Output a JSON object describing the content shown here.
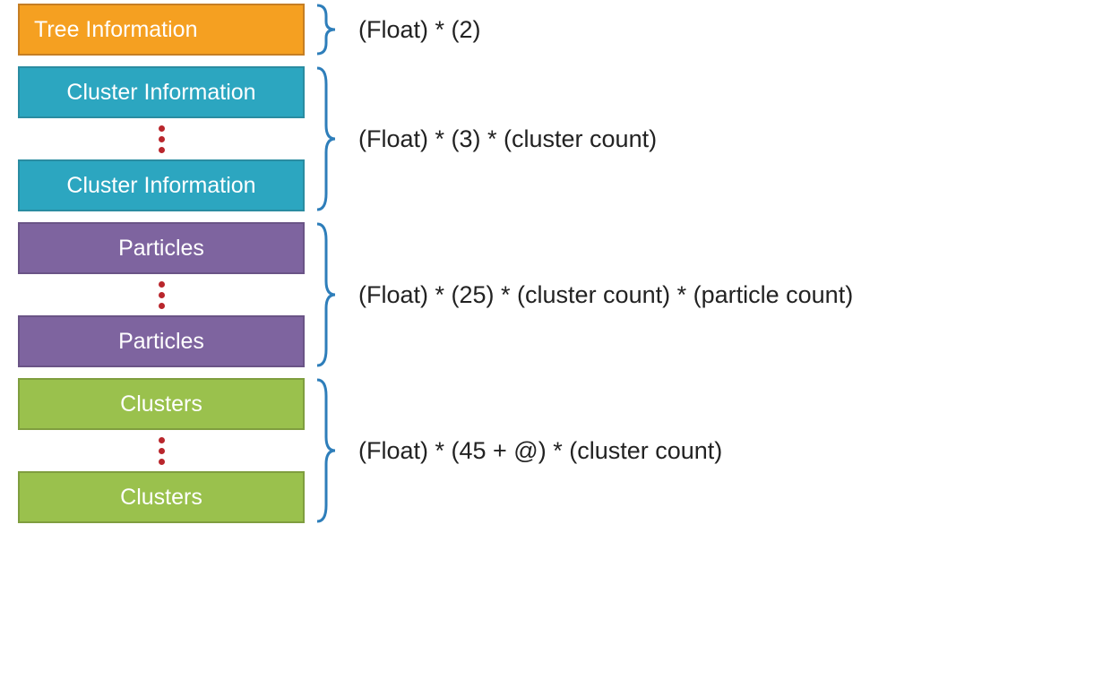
{
  "colors": {
    "orange": "#f5a021",
    "teal": "#2ca6c0",
    "purple": "#7e649f",
    "green": "#9ac14d",
    "dot": "#b9262c",
    "brace": "#2e7eba"
  },
  "sections": [
    {
      "id": "tree-info",
      "box_label": "Tree Information",
      "box_color": "orange",
      "repeated": false,
      "formula": "(Float) * (2)"
    },
    {
      "id": "cluster-info",
      "box_label": "Cluster Information",
      "box_color": "teal",
      "repeated": true,
      "formula": "(Float) * (3) * (cluster count)"
    },
    {
      "id": "particles",
      "box_label": "Particles",
      "box_color": "purple",
      "repeated": true,
      "formula": "(Float) * (25) * (cluster count) * (particle count)"
    },
    {
      "id": "clusters",
      "box_label": "Clusters",
      "box_color": "green",
      "repeated": true,
      "formula": "(Float) * (45 + @) * (cluster count)"
    }
  ]
}
